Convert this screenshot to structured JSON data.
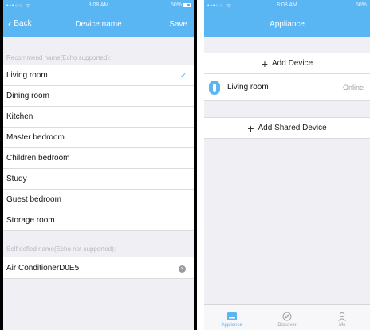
{
  "colors": {
    "accent": "#5ab5f3",
    "background": "#efeff4",
    "muted": "#b8b8c0"
  },
  "left_screen": {
    "status": {
      "signal": "•••○○ ᯤ",
      "time": "8:08 AM",
      "battery": "50%"
    },
    "nav": {
      "back_label": "Back",
      "title": "Device name",
      "save_label": "Save"
    },
    "recommend_label": "Recommend name(Echo supported):",
    "rooms": [
      {
        "label": "Living room",
        "selected": true
      },
      {
        "label": "Dining room",
        "selected": false
      },
      {
        "label": "Kitchen",
        "selected": false
      },
      {
        "label": "Master bedroom",
        "selected": false
      },
      {
        "label": "Children bedroom",
        "selected": false
      },
      {
        "label": "Study",
        "selected": false
      },
      {
        "label": "Guest bedroom",
        "selected": false
      },
      {
        "label": "Storage room",
        "selected": false
      }
    ],
    "self_defined_label": "Self defied name(Echo not supported):",
    "custom_name_value": "Air ConditionerD0E5"
  },
  "right_screen": {
    "status": {
      "signal": "•••○○ ᯤ",
      "time": "8:08 AM",
      "battery": "50%"
    },
    "nav": {
      "title": "Appliance"
    },
    "add_device_label": "Add Device",
    "device": {
      "name": "Living room",
      "status": "Online"
    },
    "add_shared_label": "Add Shared Device",
    "tabs": [
      {
        "label": "Appliance",
        "icon": "appliance-icon",
        "active": true
      },
      {
        "label": "Discover",
        "icon": "compass-icon",
        "active": false
      },
      {
        "label": "Me",
        "icon": "person-icon",
        "active": false
      }
    ]
  }
}
